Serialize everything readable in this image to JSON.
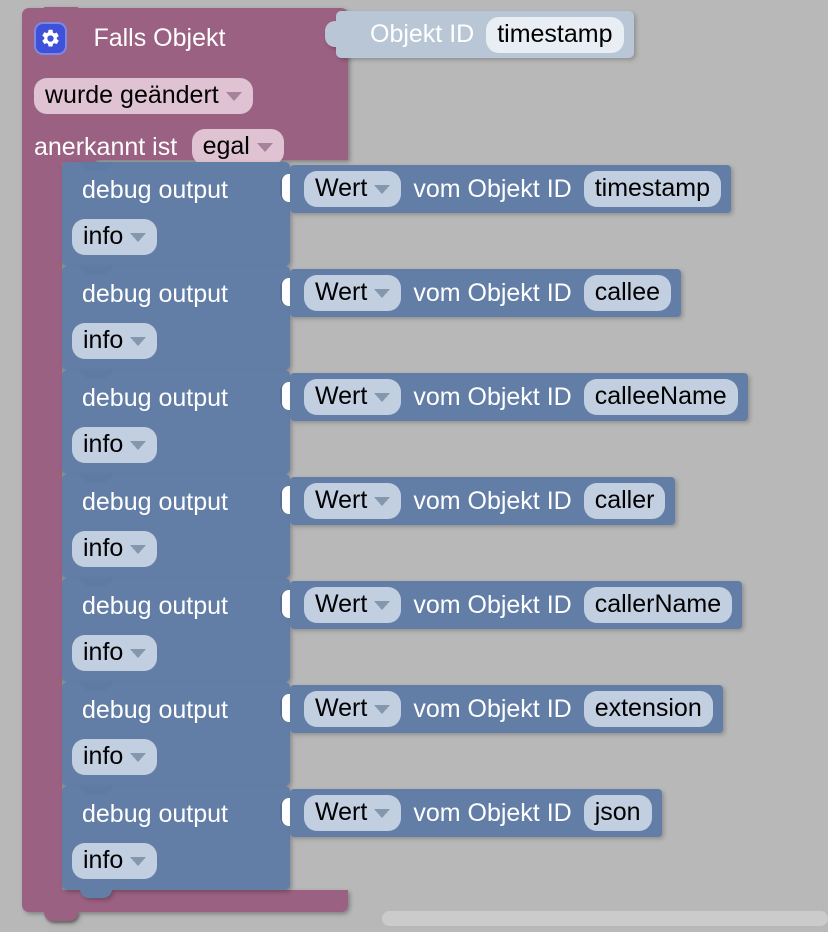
{
  "workspace": {
    "background_color": "#ffffff",
    "grid_dot_color": "#b8b8b8"
  },
  "trigger_block": {
    "color": "#9b6182",
    "gear_icon": "gear-icon",
    "title": "Falls Objekt",
    "condition_field": "wurde geändert",
    "ack_label": "anerkannt ist",
    "ack_field": "egal"
  },
  "object_id_block": {
    "color": "#b9c6d6",
    "label": "Objekt ID",
    "value": "timestamp"
  },
  "statements": [
    {
      "label": "debug output",
      "level": "info",
      "value_mode": "Wert",
      "value_label": "vom Objekt ID",
      "object_id": "timestamp"
    },
    {
      "label": "debug output",
      "level": "info",
      "value_mode": "Wert",
      "value_label": "vom Objekt ID",
      "object_id": "callee"
    },
    {
      "label": "debug output",
      "level": "info",
      "value_mode": "Wert",
      "value_label": "vom Objekt ID",
      "object_id": "calleeName"
    },
    {
      "label": "debug output",
      "level": "info",
      "value_mode": "Wert",
      "value_label": "vom Objekt ID",
      "object_id": "caller"
    },
    {
      "label": "debug output",
      "level": "info",
      "value_mode": "Wert",
      "value_label": "vom Objekt ID",
      "object_id": "callerName"
    },
    {
      "label": "debug output",
      "level": "info",
      "value_mode": "Wert",
      "value_label": "vom Objekt ID",
      "object_id": "extension"
    },
    {
      "label": "debug output",
      "level": "info",
      "value_mode": "Wert",
      "value_label": "vom Objekt ID",
      "object_id": "json"
    }
  ],
  "statement_block_color": "#637ea6"
}
